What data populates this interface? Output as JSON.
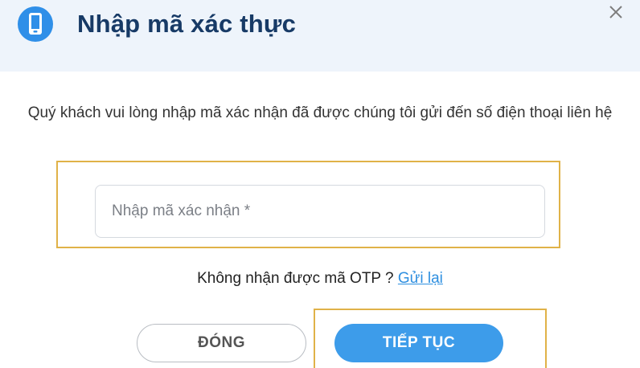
{
  "dialog": {
    "title": "Nhập mã xác thực",
    "message": "Quý khách vui lòng nhập mã xác nhận đã được chúng tôi gửi đến số điện thoại liên hệ",
    "otp_input": {
      "value": "",
      "placeholder": "Nhập mã xác nhận *"
    },
    "resend": {
      "prompt": "Không nhận được mã OTP ?",
      "link": "Gửi lại"
    },
    "buttons": {
      "close_label": "ĐÓNG",
      "next_label": "TIẾP TỤC"
    },
    "icons": {
      "header": "phone-icon",
      "close": "close-icon"
    },
    "colors": {
      "header_bg": "#eef4fb",
      "title": "#173a66",
      "accent": "#3d9cea",
      "link": "#2e8fe0",
      "highlight": "#e0b248"
    }
  }
}
